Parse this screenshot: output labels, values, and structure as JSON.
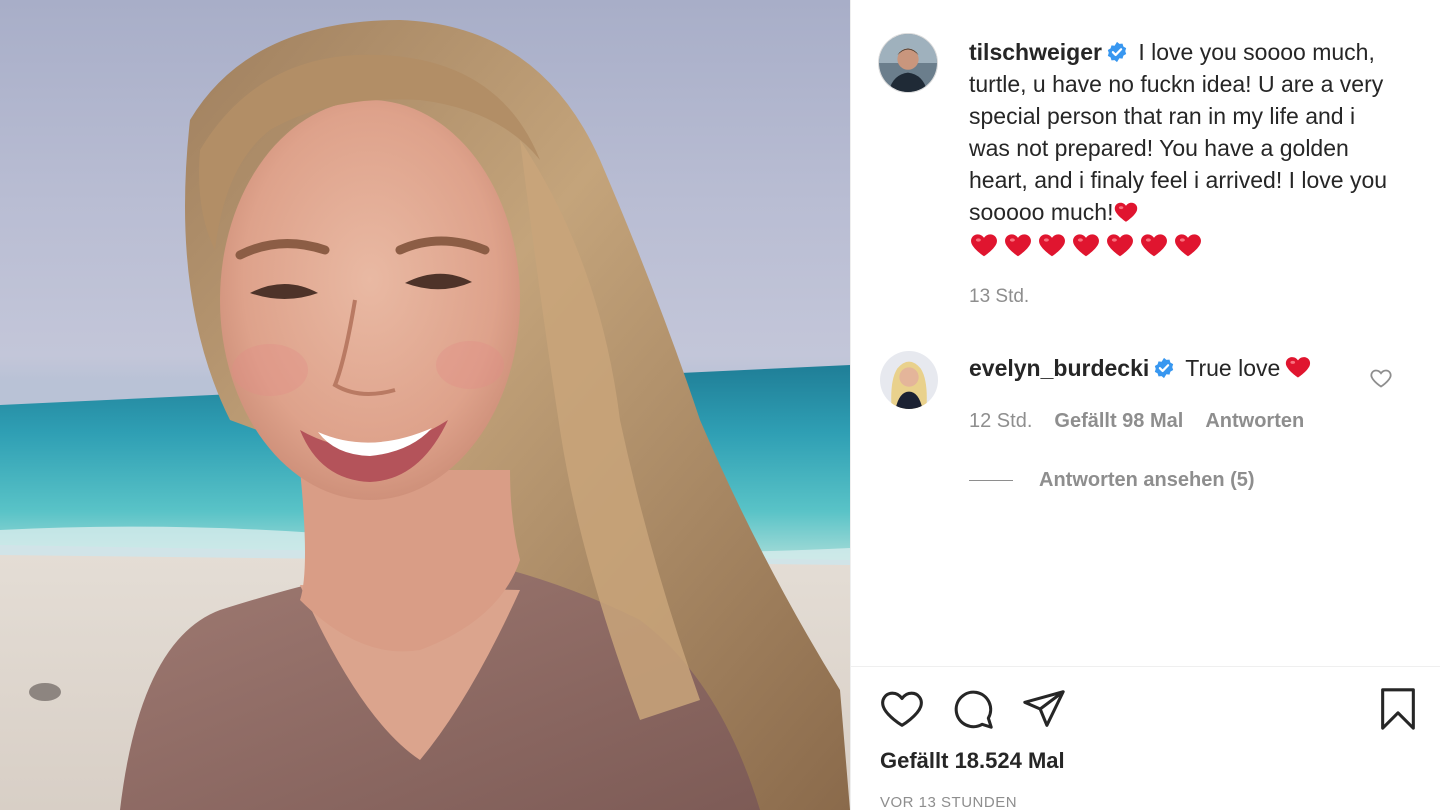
{
  "post": {
    "image_alt": "Selfie photo of a smiling woman with long blond hair on a beach at dusk",
    "author": {
      "username": "tilschweiger",
      "verified": true,
      "avatar_icon": "avatar-man-icon"
    },
    "caption": {
      "text": "I love you soooo much, turtle, u have no fuckn idea! U are a very special person that ran in my life and i was not prepared! You have a golden heart, and i finaly feel i arrived! I love you sooooo much!",
      "inline_emoji": "heart-emoji",
      "trailing_heart_count": 7
    },
    "caption_time": "13 Std.",
    "comments": [
      {
        "username": "evelyn_burdecki",
        "verified": true,
        "text": "True love",
        "emoji": "heart-emoji",
        "time": "12 Std.",
        "likes": "Gefällt 98 Mal",
        "reply_label": "Antworten",
        "view_replies": "Antworten ansehen (5)"
      }
    ],
    "actions": {
      "like_icon": "heart-outline-icon",
      "comment_icon": "comment-bubble-icon",
      "share_icon": "paper-plane-icon",
      "save_icon": "bookmark-icon"
    },
    "likes_label": "Gefällt 18.524 Mal",
    "timestamp": "VOR 13 STUNDEN"
  },
  "colors": {
    "text": "#262626",
    "muted": "#8e8e8e",
    "verified_blue": "#3897f0",
    "heart_red": "#e0152f"
  }
}
